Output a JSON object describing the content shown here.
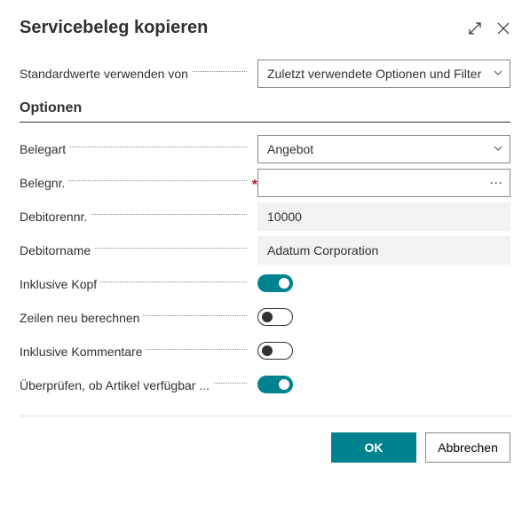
{
  "header": {
    "title": "Servicebeleg kopieren"
  },
  "defaults": {
    "label": "Standardwerte verwenden von",
    "value": "Zuletzt verwendete Optionen und Filter"
  },
  "section": {
    "title": "Optionen"
  },
  "fields": {
    "doc_type": {
      "label": "Belegart",
      "value": "Angebot"
    },
    "doc_no": {
      "label": "Belegnr.",
      "value": ""
    },
    "cust_no": {
      "label": "Debitorennr.",
      "value": "10000"
    },
    "cust_name": {
      "label": "Debitorname",
      "value": "Adatum Corporation"
    },
    "incl_header": {
      "label": "Inklusive Kopf",
      "on": true
    },
    "recalc": {
      "label": "Zeilen neu berechnen",
      "on": false
    },
    "incl_comments": {
      "label": "Inklusive Kommentare",
      "on": false
    },
    "check_avail": {
      "label": "Überprüfen, ob Artikel verfügbar ...",
      "on": true
    }
  },
  "footer": {
    "ok": "OK",
    "cancel": "Abbrechen"
  }
}
